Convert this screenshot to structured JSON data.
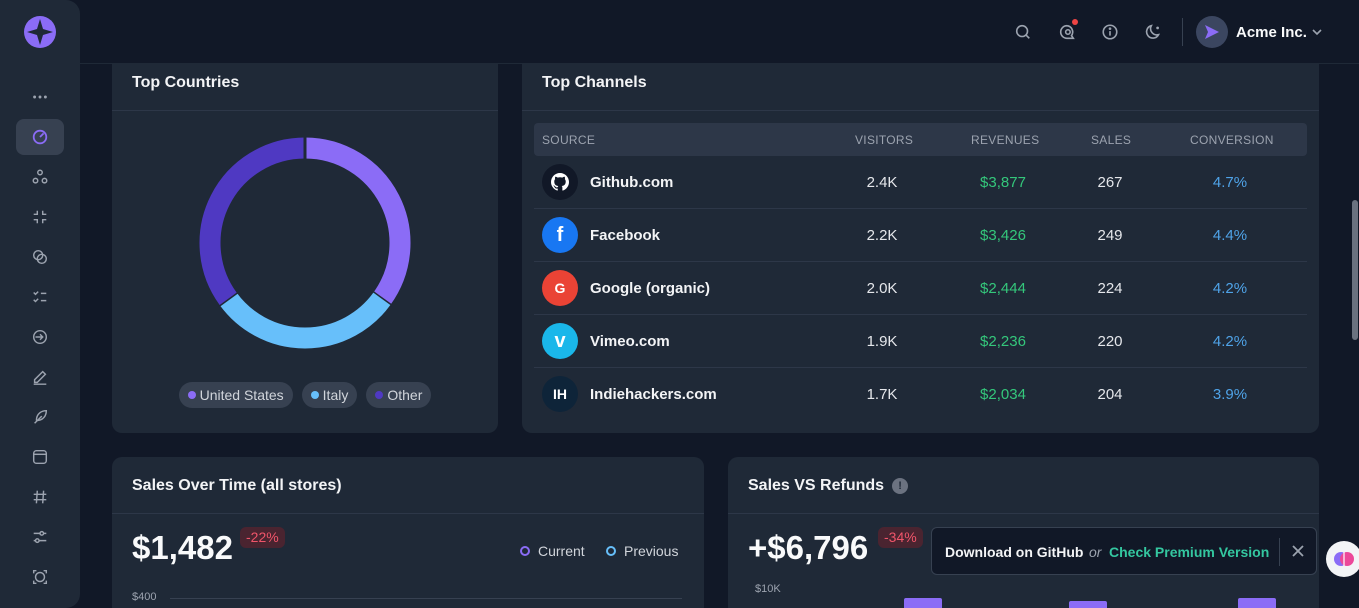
{
  "topbar": {
    "icons": [
      "search-icon",
      "chat-search-icon",
      "info-icon",
      "moon-icon"
    ],
    "user_name": "Acme Inc."
  },
  "sidebar": {
    "items": [
      "more-icon",
      "dashboard-icon",
      "community-icon",
      "collapse-icon",
      "shapes-icon",
      "tasks-icon",
      "login-icon",
      "pen-icon",
      "feather-icon",
      "calendar-icon",
      "hashtag-icon",
      "sliders-icon",
      "aperture-icon"
    ],
    "active_index": 1
  },
  "countries": {
    "title": "Top Countries",
    "legend": [
      {
        "label": "United States",
        "color": "#8b6cf6"
      },
      {
        "label": "Italy",
        "color": "#67bffa"
      },
      {
        "label": "Other",
        "color": "#4f39c2"
      }
    ],
    "chart_data": {
      "type": "pie",
      "categories": [
        "United States",
        "Italy",
        "Other"
      ],
      "values": [
        35,
        30,
        35
      ]
    }
  },
  "channels": {
    "title": "Top Channels",
    "headers": [
      "SOURCE",
      "VISITORS",
      "REVENUES",
      "SALES",
      "CONVERSION"
    ],
    "rows": [
      {
        "icon": "github-icon",
        "initials": "",
        "name": "Github.com",
        "visitors": "2.4K",
        "revenue": "$3,877",
        "sales": "267",
        "conversion": "4.7%"
      },
      {
        "icon": "facebook-icon",
        "initials": "f",
        "name": "Facebook",
        "visitors": "2.2K",
        "revenue": "$3,426",
        "sales": "249",
        "conversion": "4.4%"
      },
      {
        "icon": "google-icon",
        "initials": "G",
        "name": "Google (organic)",
        "visitors": "2.0K",
        "revenue": "$2,444",
        "sales": "224",
        "conversion": "4.2%"
      },
      {
        "icon": "vimeo-icon",
        "initials": "v",
        "name": "Vimeo.com",
        "visitors": "1.9K",
        "revenue": "$2,236",
        "sales": "220",
        "conversion": "4.2%"
      },
      {
        "icon": "indiehackers-icon",
        "initials": "IH",
        "name": "Indiehackers.com",
        "visitors": "1.7K",
        "revenue": "$2,034",
        "sales": "204",
        "conversion": "3.9%"
      }
    ]
  },
  "sales_time": {
    "title": "Sales Over Time (all stores)",
    "value": "$1,482",
    "delta": "-22%",
    "legend_current": "Current",
    "legend_previous": "Previous",
    "axis_top": "$400"
  },
  "refunds": {
    "title": "Sales VS Refunds",
    "value": "+$6,796",
    "delta": "-34%",
    "axis_top": "$10K"
  },
  "toast": {
    "download": "Download on GitHub",
    "or": "or",
    "premium": "Check Premium Version"
  },
  "colors": {
    "accent": "#8b6cf6",
    "green": "#34c77b",
    "blue": "#4fa3e8",
    "red": "#f0556a"
  }
}
